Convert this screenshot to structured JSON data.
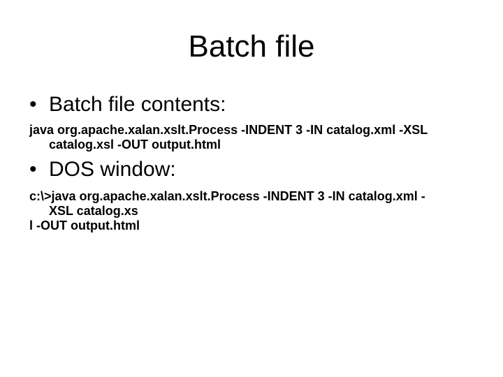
{
  "slide": {
    "title": "Batch file",
    "bullets": [
      {
        "marker": "•",
        "label": "Batch file contents:",
        "lines": [
          "java org.apache.xalan.xslt.Process -INDENT 3 -IN catalog.xml -XSL",
          "catalog.xsl -OUT output.html"
        ]
      },
      {
        "marker": "•",
        "label": "DOS window:",
        "lines": [
          "c:\\>java org.apache.xalan.xslt.Process -INDENT 3 -IN catalog.xml -",
          "XSL catalog.xs",
          "l -OUT output.html"
        ]
      }
    ]
  }
}
